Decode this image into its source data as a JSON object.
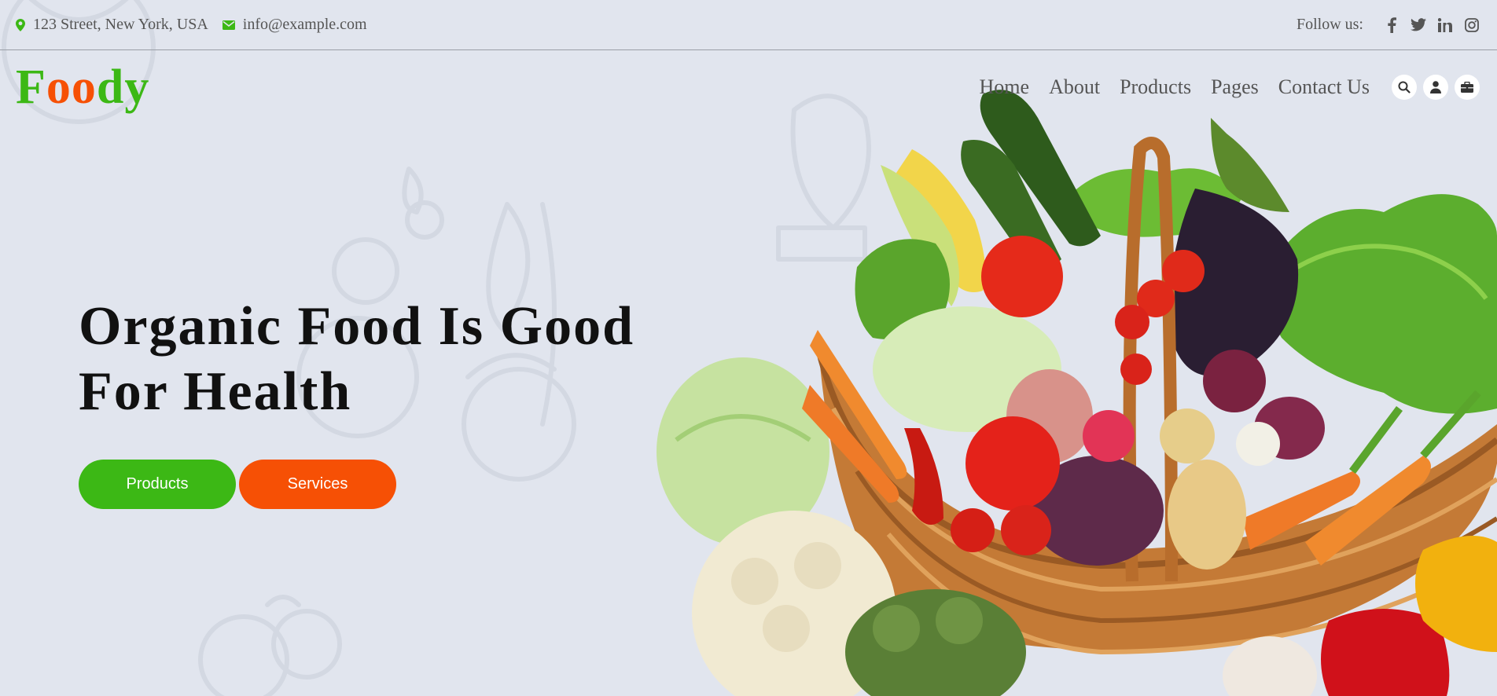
{
  "topbar": {
    "address": "123 Street, New York, USA",
    "email": "info@example.com",
    "follow_label": "Follow us:",
    "social_icons": [
      "facebook-icon",
      "twitter-icon",
      "linkedin-icon",
      "instagram-icon"
    ]
  },
  "brand": {
    "logo_first": "F",
    "logo_rest": "oody"
  },
  "nav": {
    "links": [
      "Home",
      "About",
      "Products",
      "Pages",
      "Contact Us"
    ],
    "icons": [
      "search-icon",
      "user-icon",
      "briefcase-icon"
    ]
  },
  "hero": {
    "title_line1": "Organic Food Is Good",
    "title_line2": "For Health",
    "primary_button": "Products",
    "secondary_button": "Services"
  },
  "colors": {
    "primary": "#3cb815",
    "secondary": "#f65005",
    "background": "#e1e5ee",
    "heading": "#111111"
  }
}
